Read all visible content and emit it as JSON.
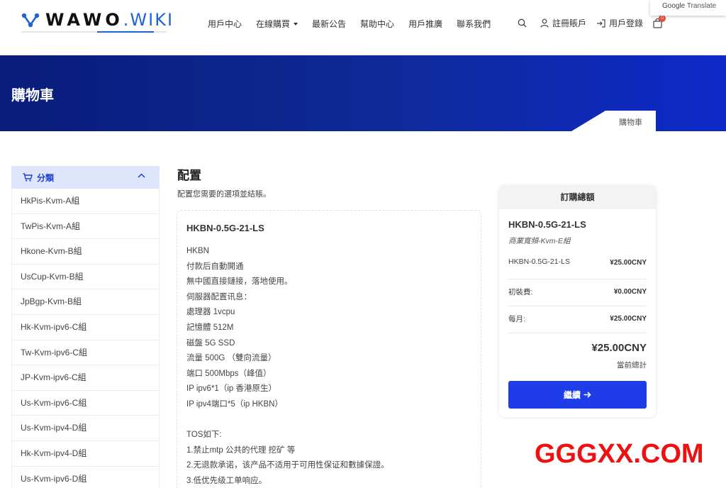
{
  "header": {
    "logo_text": "WAWO",
    "logo_suffix": ".WIKI",
    "nav": [
      {
        "label": "用戶中心"
      },
      {
        "label": "在線購買",
        "has_dropdown": true
      },
      {
        "label": "最新公告"
      },
      {
        "label": "幫助中心"
      },
      {
        "label": "用戶推廣"
      },
      {
        "label": "聯系我們"
      }
    ],
    "register_label": "註冊賬戶",
    "login_label": "用戶登錄",
    "cart_count": "0"
  },
  "google_translate": {
    "brand": "Google",
    "label": "Translate"
  },
  "banner": {
    "title": "購物車",
    "breadcrumb": "購物車"
  },
  "sidebar": {
    "heading": "分類",
    "items": [
      {
        "label": "HkPis-Kvm-A組"
      },
      {
        "label": "TwPis-Kvm-A組"
      },
      {
        "label": "Hkone-Kvm-B組"
      },
      {
        "label": "UsCup-Kvm-B組"
      },
      {
        "label": "JpBgp-Kvm-B組"
      },
      {
        "label": "Hk-Kvm-ipv6-C組"
      },
      {
        "label": "Tw-Kvm-ipv6-C組"
      },
      {
        "label": "JP-Kvm-ipv6-C組"
      },
      {
        "label": "Us-Kvm-ipv6-C組"
      },
      {
        "label": "Us-Kvm-ipv4-D組"
      },
      {
        "label": "Hk-Kvm-ipv4-D組"
      },
      {
        "label": "Us-Kvm-ipv6-D組"
      }
    ]
  },
  "main": {
    "title": "配置",
    "subtitle": "配置您需要的選項並結賬。",
    "product_name": "HKBN-0.5G-21-LS",
    "description": [
      "HKBN",
      "付款后自動開通",
      "無中國直接鏈接，落地使用。",
      "伺服器配置讯息：",
      "處理器 1vcpu",
      "記憶體 512M",
      "磁盤 5G SSD",
      "流量 500G （雙向流量）",
      "端口 500Mbps（峰值）",
      "IP ipv6*1（ip 香港原生）",
      "IP ipv4端口*5（ip HKBN）",
      "",
      "TOS如下:",
      "1.禁止mtp 公共的代理 挖矿 等",
      "2.无退款承诺，该产品不适用于可用性保证和數據保證。",
      "3.低优先级工单响应。"
    ]
  },
  "summary": {
    "heading": "訂購總額",
    "product": "HKBN-0.5G-21-LS",
    "group": "商業寬頻-Kvm-E組",
    "lines": [
      {
        "label": "HKBN-0.5G-21-LS",
        "amount": "¥25.00CNY"
      },
      {
        "label": "初裝費:",
        "amount": "¥0.00CNY"
      },
      {
        "label": "每月:",
        "amount": "¥25.00CNY"
      }
    ],
    "total": "¥25.00CNY",
    "total_label": "當前總計",
    "continue_label": "繼續"
  },
  "watermark": "GGGXX.COM",
  "colors": {
    "brand_blue": "#1f63d8",
    "button_blue": "#1e3ce8",
    "banner_dark": "#0a1c7a",
    "sidebar_head_bg": "#dfe5fb",
    "watermark_red": "#ee1111"
  }
}
